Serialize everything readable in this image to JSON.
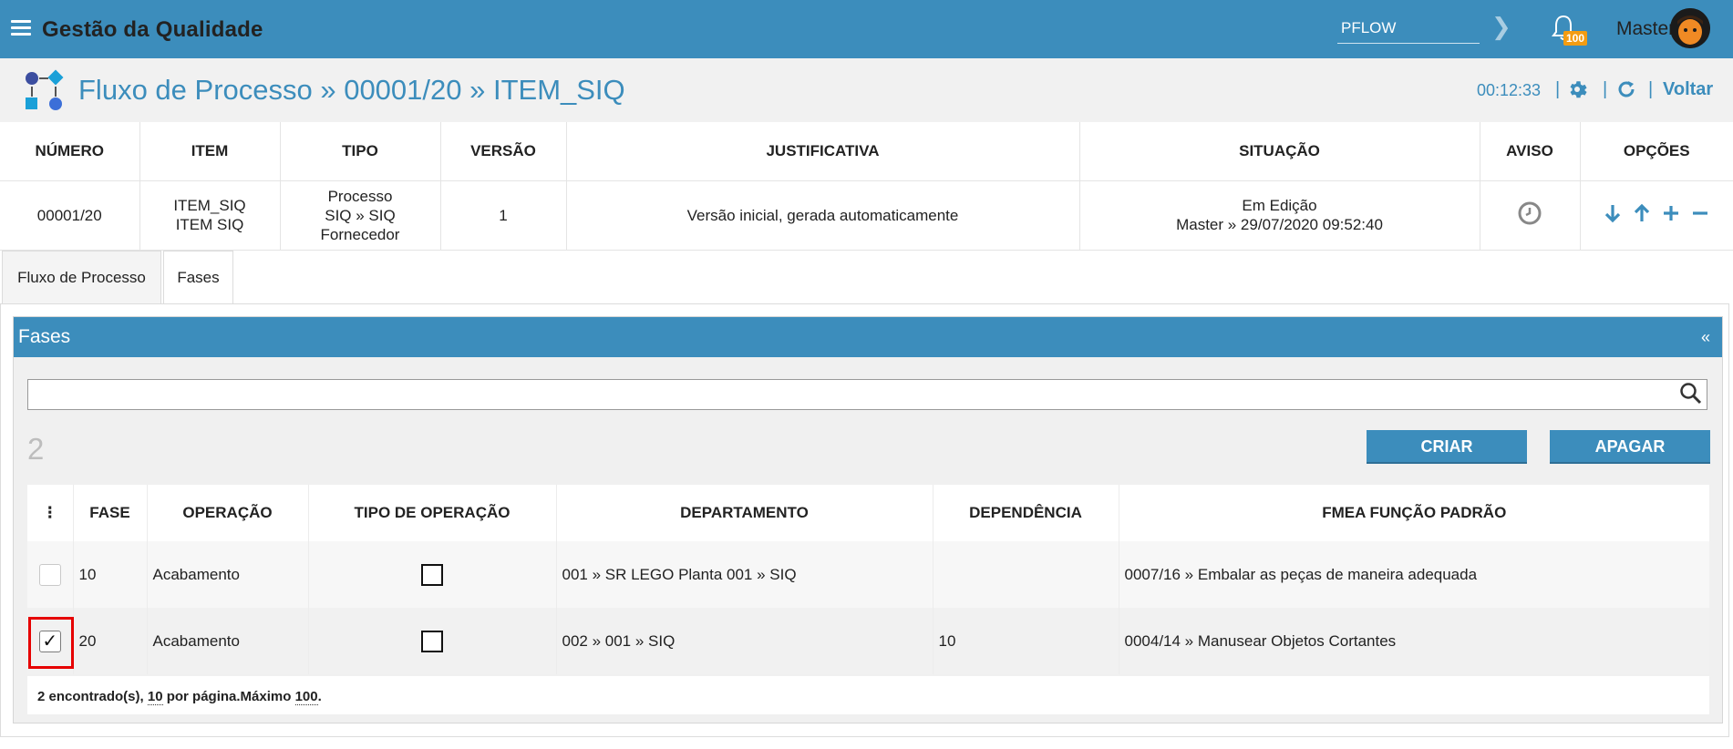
{
  "app": {
    "title": "Gestão da Qualidade"
  },
  "topbar": {
    "module_value": "PFLOW",
    "notification_count": "100",
    "user_name": "Master"
  },
  "header": {
    "title": "Fluxo de Processo » 00001/20 » ITEM_SIQ",
    "timer": "00:12:33",
    "separator": "|",
    "back_label": "Voltar"
  },
  "info": {
    "columns": [
      "NÚMERO",
      "ITEM",
      "TIPO",
      "VERSÃO",
      "JUSTIFICATIVA",
      "SITUAÇÃO",
      "AVISO",
      "OPÇÕES"
    ],
    "row": {
      "numero": "00001/20",
      "item_code": "ITEM_SIQ",
      "item_name": "ITEM SIQ",
      "tipo_1": "Processo",
      "tipo_2": "SIQ » SIQ",
      "tipo_3": "Fornecedor",
      "versao": "1",
      "justificativa": "Versão inicial, gerada automaticamente",
      "situacao_status": "Em Edição",
      "situacao_detail": "Master » 29/07/2020 09:52:40"
    }
  },
  "tabs": [
    {
      "label": "Fluxo de Processo",
      "active": false
    },
    {
      "label": "Fases",
      "active": true
    }
  ],
  "fases": {
    "title": "Fases",
    "collapse": "«",
    "search_value": "",
    "count": "2",
    "create_label": "CRIAR",
    "delete_label": "APAGAR",
    "columns": [
      "⋮",
      "FASE",
      "OPERAÇÃO",
      "TIPO DE OPERAÇÃO",
      "DEPARTAMENTO",
      "DEPENDÊNCIA",
      "FMEA FUNÇÃO PADRÃO"
    ],
    "rows": [
      {
        "checked": false,
        "fase": "10",
        "operacao": "Acabamento",
        "departamento": "001 » SR LEGO Planta 001 » SIQ",
        "dependencia": "",
        "fmea": "0007/16 » Embalar as peças de maneira adequada"
      },
      {
        "checked": true,
        "fase": "20",
        "operacao": "Acabamento",
        "departamento": "002 » 001 » SIQ",
        "dependencia": "10",
        "fmea": "0004/14 » Manusear Objetos Cortantes"
      }
    ],
    "checkmark": "✓",
    "footer": {
      "found": "2 encontrado(s),",
      "per_page": "10",
      "per_page_label": "por página.Máximo",
      "max": "100",
      "end": "."
    }
  }
}
